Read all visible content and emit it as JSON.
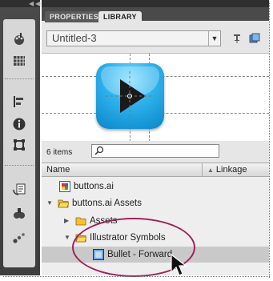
{
  "panel": {
    "tabs": [
      {
        "label": "PROPERTIES"
      },
      {
        "label": "LIBRARY"
      }
    ],
    "document_select": {
      "value": "Untitled-3"
    }
  },
  "library": {
    "item_count": "6 items",
    "search": {
      "placeholder": ""
    },
    "columns": {
      "name": "Name",
      "linkage": "Linkage"
    },
    "items": [
      {
        "label": "buttons.ai",
        "icon": "ai-file-icon",
        "expanded": null
      },
      {
        "label": "buttons.ai Assets",
        "icon": "folder-icon",
        "expanded": true
      },
      {
        "label": "Assets",
        "icon": "folder-icon",
        "expanded": false
      },
      {
        "label": "Illustrator Symbols",
        "icon": "folder-icon",
        "expanded": true
      },
      {
        "label": "Bullet - Forward",
        "icon": "symbol-icon",
        "selected": true
      }
    ]
  },
  "colors": {
    "toolstrip": "#444444",
    "panel_bg": "#e6e6e6",
    "button_blue": "#2fb4ee",
    "folder_yellow": "#f2c230",
    "highlight_ellipse": "#a0215a"
  }
}
